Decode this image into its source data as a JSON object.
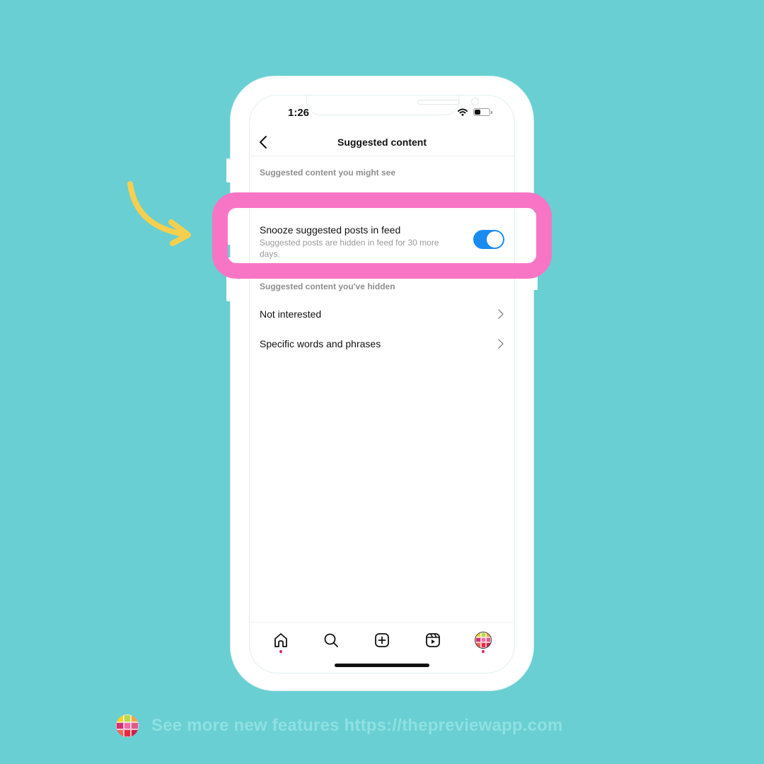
{
  "colors": {
    "background": "#69cfd2",
    "highlight": "#f875c6",
    "arrow": "#f7cf4e",
    "toggle_on": "#1a8cf0",
    "notification_dot": "#e0245e",
    "footer_text": "#8fe0e2"
  },
  "status_bar": {
    "time": "1:26",
    "icons": [
      "wifi-icon",
      "battery-icon"
    ]
  },
  "header": {
    "back_icon": "chevron-left-icon",
    "title": "Suggested content"
  },
  "sections": {
    "might_see_label": "Suggested content you might see",
    "hidden_label": "Suggested content you've hidden"
  },
  "snooze": {
    "title": "Snooze suggested posts in feed",
    "subtitle": "Suggested posts are hidden in feed for 30 more days.",
    "enabled": true
  },
  "hidden_items": [
    {
      "label": "Not interested",
      "icon": "chevron-right-icon"
    },
    {
      "label": "Specific words and phrases",
      "icon": "chevron-right-icon"
    }
  ],
  "tab_bar": {
    "tabs": [
      {
        "name": "home",
        "icon": "home-icon",
        "has_dot": true
      },
      {
        "name": "search",
        "icon": "search-icon",
        "has_dot": false
      },
      {
        "name": "create",
        "icon": "plus-square-icon",
        "has_dot": false
      },
      {
        "name": "reels",
        "icon": "reels-icon",
        "has_dot": false
      },
      {
        "name": "profile",
        "icon": "avatar-icon",
        "has_dot": true
      }
    ]
  },
  "logo_colors": [
    "#f6d02a",
    "#b9d94a",
    "#f3a44a",
    "#d4306e",
    "#f46ca4",
    "#e05a8c",
    "#f1655b",
    "#e8293f",
    "#c9234f"
  ],
  "footer": {
    "text": "See more new features https://thepreviewapp.com"
  }
}
